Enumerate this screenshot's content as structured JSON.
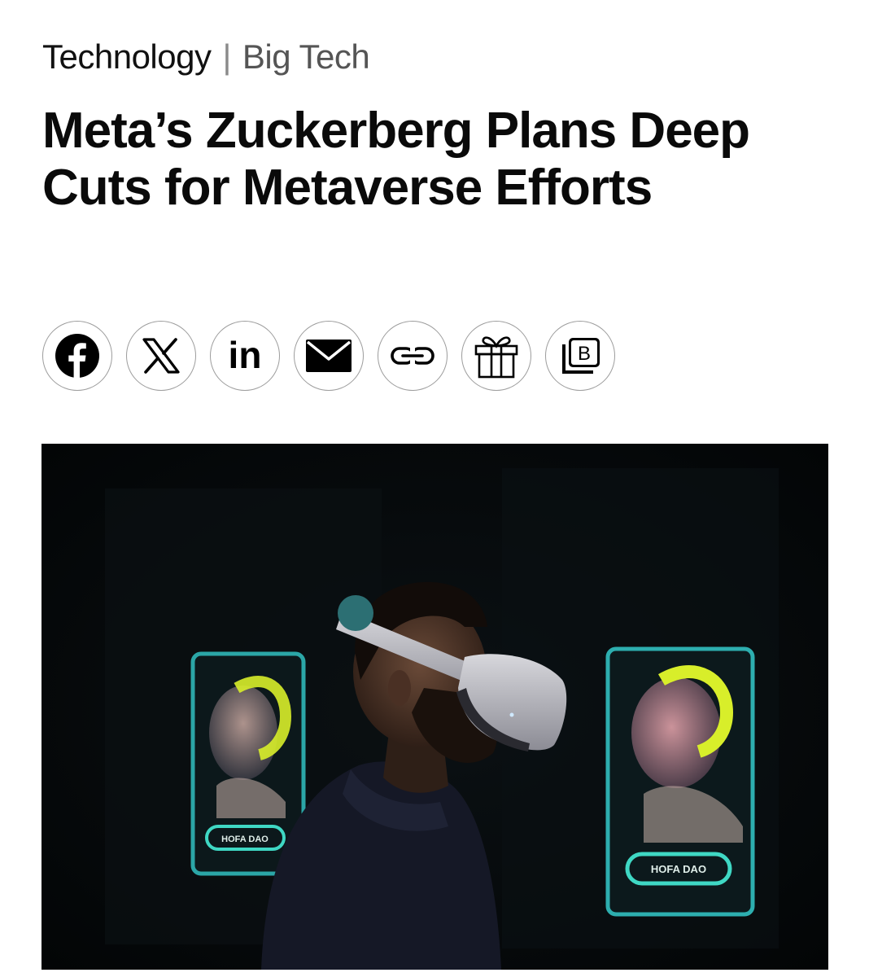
{
  "breadcrumb": {
    "section": "Technology",
    "separator": "|",
    "subsection": "Big Tech"
  },
  "article": {
    "headline": "Meta’s Zuckerberg Plans Deep Cuts for Metaverse Efforts"
  },
  "share_buttons": [
    {
      "icon": "facebook-icon"
    },
    {
      "icon": "x-icon"
    },
    {
      "icon": "linkedin-icon",
      "glyph": "in"
    },
    {
      "icon": "email-icon"
    },
    {
      "icon": "link-icon"
    },
    {
      "icon": "gift-icon"
    },
    {
      "icon": "bloomberg-terminal-icon",
      "glyph": "B"
    }
  ],
  "hero_image": {
    "screen_labels": [
      "HOFA DAO",
      "HOFA DAO"
    ]
  },
  "colors": {
    "text": "#0a0a0a",
    "secondary_text": "#555555",
    "button_border": "#9c9c9c",
    "photo_background": "#050708",
    "screen_frame": "#2fb7b8",
    "accent_yellow": "#d8ee2a"
  }
}
